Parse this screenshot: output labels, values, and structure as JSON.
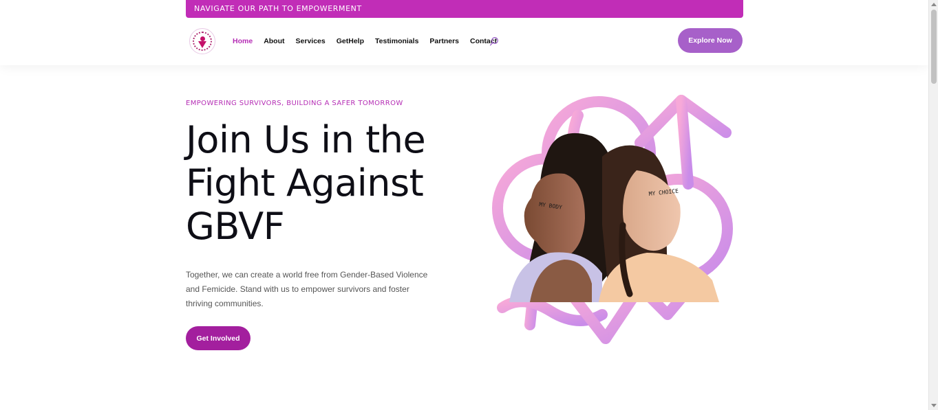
{
  "topbar": {
    "text": "NAVIGATE OUR PATH TO EMPOWERMENT"
  },
  "logo": {
    "alt": "organization logo"
  },
  "nav": {
    "items": [
      {
        "label": "Home",
        "active": true
      },
      {
        "label": "About",
        "active": false
      },
      {
        "label": "Services",
        "active": false
      },
      {
        "label": "GetHelp",
        "active": false
      },
      {
        "label": "Testimonials",
        "active": false
      },
      {
        "label": "Partners",
        "active": false
      },
      {
        "label": "Contact",
        "active": false
      }
    ],
    "search_icon": "search-icon"
  },
  "header": {
    "explore_label": "Explore Now"
  },
  "hero": {
    "eyebrow": "EMPOWERING SURVIVORS, BUILDING A SAFER TOMORROW",
    "title_line1": "Join Us in the",
    "title_line2": "Fight Against",
    "title_line3": "GBVF",
    "description": "Together, we can create a world free from Gender-Based Violence and Femicide. Stand with us to empower survivors and foster thriving communities.",
    "cta_label": "Get Involved",
    "image_text_left": "MY BODY",
    "image_text_right": "MY CHOICE"
  },
  "colors": {
    "brand": "#c12db7",
    "nav_active": "#b52db5",
    "explore_button": "#a760c9",
    "cta_button": "#a31f9e"
  }
}
